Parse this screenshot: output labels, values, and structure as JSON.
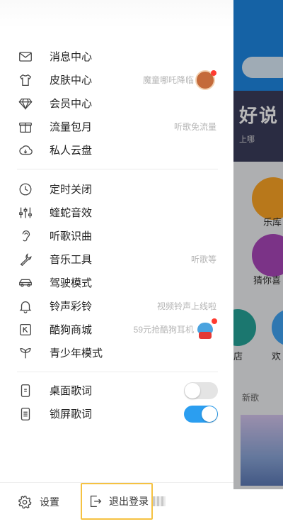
{
  "drawer": {
    "group1": [
      {
        "label": "消息中心",
        "icon": "mail-icon",
        "hint": ""
      },
      {
        "label": "皮肤中心",
        "icon": "tshirt-icon",
        "hint": "魔童哪吒降临"
      },
      {
        "label": "会员中心",
        "icon": "diamond-icon",
        "hint": ""
      },
      {
        "label": "流量包月",
        "icon": "gift-icon",
        "hint": "听歌免流量"
      },
      {
        "label": "私人云盘",
        "icon": "cloud-icon",
        "hint": ""
      }
    ],
    "group2": [
      {
        "label": "定时关闭",
        "icon": "clock-icon",
        "hint": ""
      },
      {
        "label": "蝰蛇音效",
        "icon": "equalizer-icon",
        "hint": ""
      },
      {
        "label": "听歌识曲",
        "icon": "ear-icon",
        "hint": ""
      },
      {
        "label": "音乐工具",
        "icon": "wrench-icon",
        "hint": "听歌等"
      },
      {
        "label": "驾驶模式",
        "icon": "car-icon",
        "hint": ""
      },
      {
        "label": "铃声彩铃",
        "icon": "bell-icon",
        "hint": "视频铃声上线啦"
      },
      {
        "label": "酷狗商城",
        "icon": "shop-icon",
        "hint": "59元抢酷狗耳机"
      },
      {
        "label": "青少年模式",
        "icon": "sprout-icon",
        "hint": ""
      }
    ],
    "group3": [
      {
        "label": "桌面歌词",
        "icon": "phone-icon",
        "toggle": "off"
      },
      {
        "label": "锁屏歌词",
        "icon": "lockscreen-icon",
        "toggle": "on"
      }
    ],
    "footer": {
      "settings_label": "设置",
      "logout_label": "退出登录"
    }
  },
  "background": {
    "banner_text": "好说",
    "banner_sub": "上哪",
    "shortcut_1": "乐库",
    "shortcut_2": "猜你喜",
    "shortcut_3": "店",
    "shortcut_4": "欢",
    "section_new": "新歌"
  },
  "colors": {
    "toggle_on": "#2b9ef0",
    "toggle_off": "#e4e4e4",
    "highlight_border": "#f5c242",
    "badge_red": "#ff3b30"
  }
}
